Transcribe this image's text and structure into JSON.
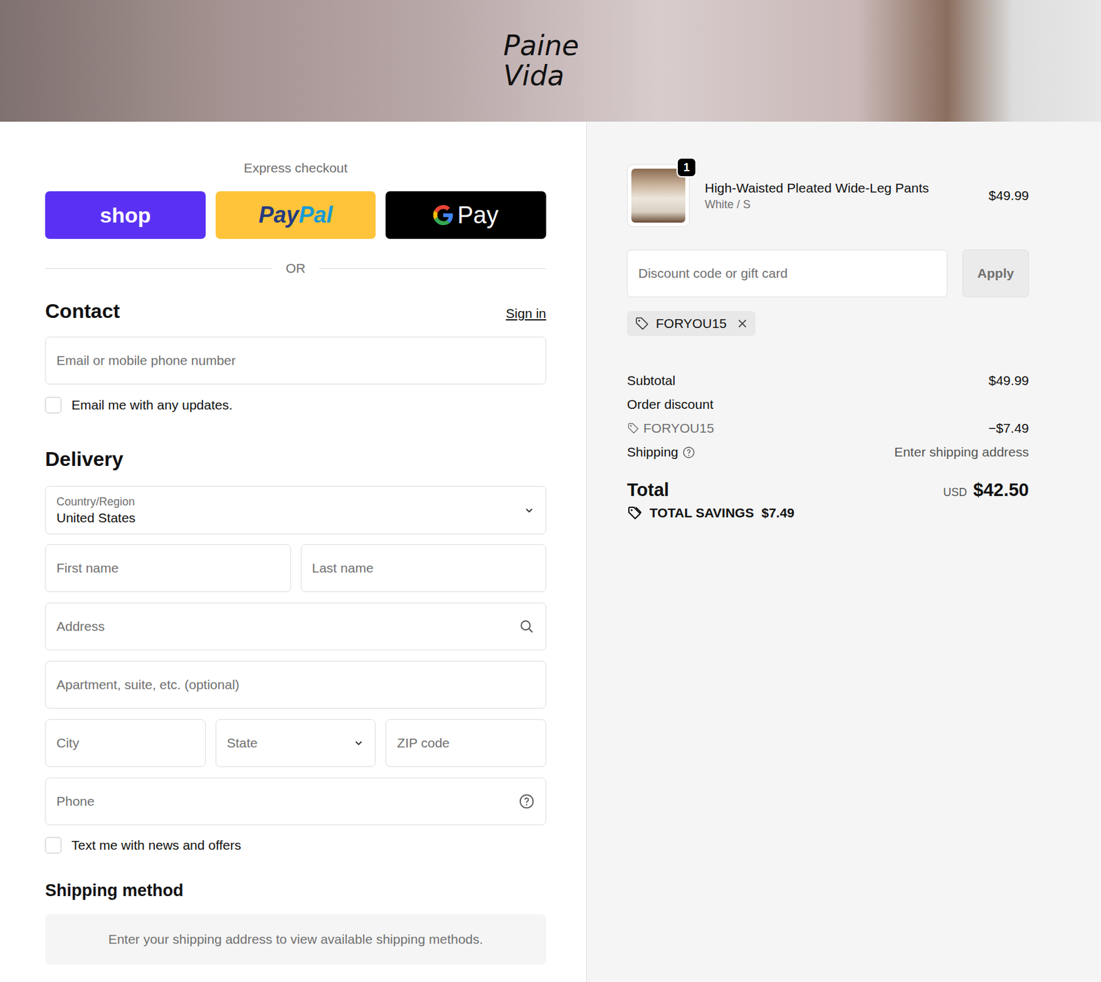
{
  "header": {
    "logo": [
      "Paine",
      "Vida"
    ]
  },
  "express": {
    "title": "Express checkout",
    "shop": "shop",
    "paypal": [
      "Pay",
      "Pal"
    ],
    "gpay": "Pay",
    "divider": "OR"
  },
  "contact": {
    "title": "Contact",
    "sign_in": "Sign in",
    "email_placeholder": "Email or mobile phone number",
    "marketing": {
      "label": "Email me with any updates.",
      "checked": false
    }
  },
  "delivery": {
    "title": "Delivery",
    "country": {
      "label": "Country/Region",
      "value": "United States"
    },
    "rows": [
      [
        {
          "placeholder": "First name",
          "kind": "text"
        },
        {
          "placeholder": "Last name",
          "kind": "text"
        }
      ],
      [
        {
          "placeholder": "Address",
          "kind": "search"
        }
      ],
      [
        {
          "placeholder": "Apartment, suite, etc. (optional)",
          "kind": "text"
        }
      ],
      [
        {
          "placeholder": "City",
          "kind": "text"
        },
        {
          "placeholder": "State",
          "kind": "select"
        },
        {
          "placeholder": "ZIP code",
          "kind": "text"
        }
      ],
      [
        {
          "placeholder": "Phone",
          "kind": "help"
        }
      ]
    ],
    "sms": {
      "label": "Text me with news and offers",
      "checked": false
    }
  },
  "shipping_method": {
    "title": "Shipping method",
    "note": "Enter your shipping address to view available shipping methods."
  },
  "summary": {
    "items": [
      {
        "name": "High-Waisted Pleated Wide-Leg Pants",
        "variant": "White / S",
        "price": "$49.99",
        "quantity": "1"
      }
    ],
    "discount": {
      "placeholder": "Discount code or gift card",
      "button": "Apply",
      "applied": [
        "FORYOU15"
      ]
    },
    "subtotal": {
      "label": "Subtotal",
      "value": "$49.99"
    },
    "order_discount": {
      "label": "Order discount",
      "code": "FORYOU15",
      "value": "−$7.49"
    },
    "shipping": {
      "label": "Shipping",
      "value": "Enter shipping address"
    },
    "total": {
      "label": "Total",
      "currency": "USD",
      "value": "$42.50"
    },
    "savings": {
      "label": "TOTAL SAVINGS",
      "value": "$7.49"
    }
  }
}
